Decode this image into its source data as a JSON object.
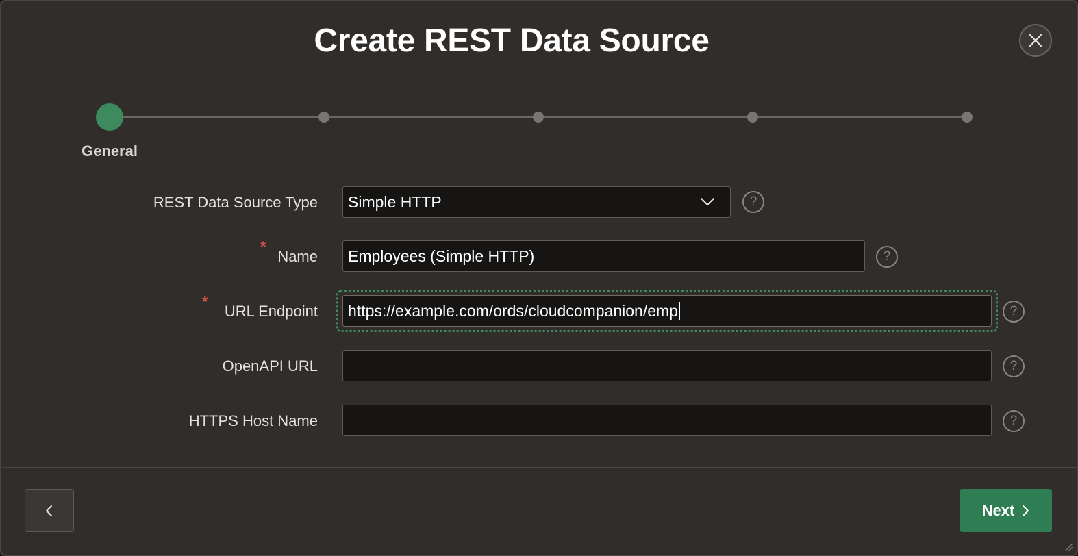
{
  "dialog": {
    "title": "Create REST Data Source",
    "close_icon": "close-icon"
  },
  "wizard": {
    "current_step_label": "General",
    "total_steps": 5,
    "current_step": 1
  },
  "form": {
    "type": {
      "label": "REST Data Source Type",
      "value": "Simple HTTP",
      "icon": "chevron-down-icon"
    },
    "name": {
      "required_marker": "*",
      "label": "Name",
      "value": "Employees (Simple HTTP)"
    },
    "url_endpoint": {
      "required_marker": "*",
      "label": "URL Endpoint",
      "value": "https://example.com/ords/cloudcompanion/emp"
    },
    "openapi_url": {
      "label": "OpenAPI URL",
      "value": ""
    },
    "https_host": {
      "label": "HTTPS Host Name",
      "value": ""
    },
    "help_glyph": "?"
  },
  "footer": {
    "back_icon": "chevron-left-icon",
    "next_label": "Next",
    "next_icon": "chevron-right-icon"
  },
  "colors": {
    "background": "#312d2a",
    "accent": "#2f7d52",
    "required": "#d9534a"
  }
}
